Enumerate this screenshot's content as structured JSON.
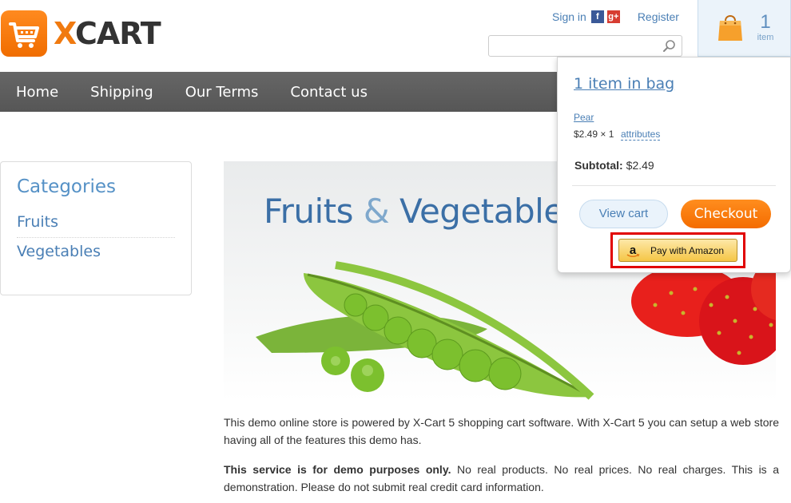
{
  "header": {
    "logo_text": "XCART",
    "sign_in": "Sign in",
    "facebook_icon": "f",
    "google_icon": "g+",
    "register": "Register",
    "search": {
      "value": "",
      "placeholder": ""
    }
  },
  "minicart": {
    "count": "1",
    "label": "item"
  },
  "nav": {
    "items": [
      {
        "label": "Home"
      },
      {
        "label": "Shipping"
      },
      {
        "label": "Our Terms"
      },
      {
        "label": "Contact us"
      }
    ]
  },
  "sidebar": {
    "title": "Categories",
    "items": [
      {
        "label": "Fruits"
      },
      {
        "label": "Vegetables"
      }
    ]
  },
  "banner": {
    "title_part1": "Fruits",
    "title_amp": "&",
    "title_part2": "Vegetables"
  },
  "content": {
    "p1": "This demo online store is powered by X-Cart 5 shopping cart software. With X-Cart 5 you can setup a web store having all of the features this demo has.",
    "p2_bold": "This service is for demo purposes only.",
    "p2_rest": " No real products. No real prices. No real charges. This is a demonstration. Please do not submit real credit card information."
  },
  "popup": {
    "title": "1 item in bag",
    "item_name": "Pear",
    "item_price": "$2.49 × 1",
    "attributes": "attributes",
    "subtotal_label": "Subtotal:",
    "subtotal_value": "$2.49",
    "view_cart": "View cart",
    "checkout": "Checkout",
    "amazon": "Pay with Amazon"
  },
  "colors": {
    "accent_orange": "#f47a10",
    "link_blue": "#4a7fb5",
    "nav_bg": "#5e5e5e",
    "highlight_red": "#e10000"
  }
}
